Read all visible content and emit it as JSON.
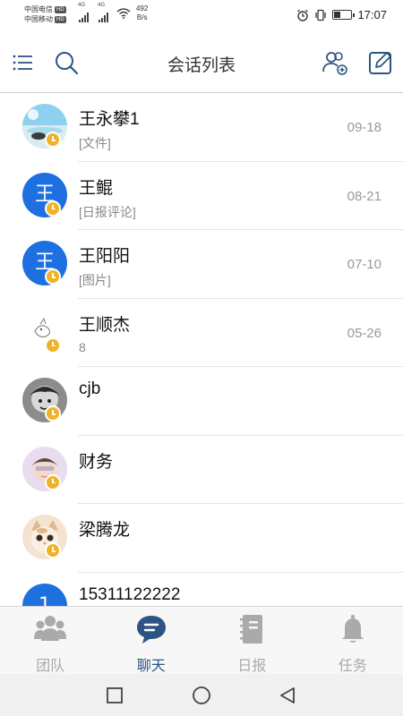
{
  "status_bar": {
    "carrier1": "中国电信",
    "carrier2": "中国移动",
    "hd": "HD",
    "net_speed_value": "492",
    "net_speed_unit": "B/s",
    "time": "17:07"
  },
  "header": {
    "title": "会话列表"
  },
  "conversations": [
    {
      "name": "王永攀1",
      "preview": "[文件]",
      "date": "09-18",
      "avatar_type": "photo-beach",
      "avatar_text": ""
    },
    {
      "name": "王鲲",
      "preview": "[日报评论]",
      "date": "08-21",
      "avatar_type": "initial",
      "avatar_text": "王"
    },
    {
      "name": "王阳阳",
      "preview": "[图片]",
      "date": "07-10",
      "avatar_type": "initial",
      "avatar_text": "王"
    },
    {
      "name": "王顺杰",
      "preview": "8",
      "date": "05-26",
      "avatar_type": "photo-sketch",
      "avatar_text": ""
    },
    {
      "name": "cjb",
      "preview": "",
      "date": "",
      "avatar_type": "photo-gray",
      "avatar_text": ""
    },
    {
      "name": "财务",
      "preview": "",
      "date": "",
      "avatar_type": "photo-girl",
      "avatar_text": ""
    },
    {
      "name": "梁腾龙",
      "preview": "",
      "date": "",
      "avatar_type": "photo-cat",
      "avatar_text": ""
    },
    {
      "name": "15311122222",
      "preview": "",
      "date": "",
      "avatar_type": "initial",
      "avatar_text": "1"
    }
  ],
  "tabs": [
    {
      "label": "团队",
      "icon": "team-icon",
      "active": false
    },
    {
      "label": "聊天",
      "icon": "chat-icon",
      "active": true
    },
    {
      "label": "日报",
      "icon": "daily-report-icon",
      "active": false
    },
    {
      "label": "任务",
      "icon": "bell-icon",
      "active": false
    }
  ],
  "colors": {
    "accent": "#2d5584",
    "avatar_blue": "#1e6fe0",
    "badge": "#f1b326",
    "inactive": "#aaaaaa"
  }
}
